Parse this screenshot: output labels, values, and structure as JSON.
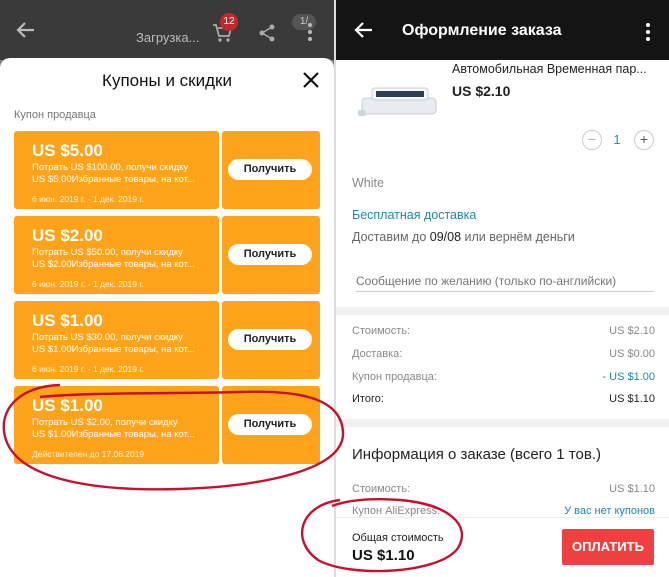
{
  "left": {
    "topbar": {
      "title": "Загрузка...",
      "cart_count": "12",
      "pager": "1/"
    },
    "sheet": {
      "title": "Купоны и скидки",
      "section_label": "Купон продавца",
      "coupons": [
        {
          "amount": "US $5.00",
          "line1": "Потрать US $100.00, получи скидку",
          "line2": "US $5.00Избранные товары, на кот...",
          "date": "6 июн. 2019 г. - 1 дек. 2019 г.",
          "button": "Получить"
        },
        {
          "amount": "US $2.00",
          "line1": "Потрать US $50.00, получи скидку",
          "line2": "US $2.00Избранные товары, на кот...",
          "date": "6 июн. 2019 г. - 1 дек. 2019 г.",
          "button": "Получить"
        },
        {
          "amount": "US $1.00",
          "line1": "Потрать US $30.00, получи скидку",
          "line2": "US $1.00Избранные товары, на кот...",
          "date": "6 июн. 2019 г. - 1 дек. 2019 г.",
          "button": "Получить"
        },
        {
          "amount": "US $1.00",
          "line1": "Потрать US $2.00, получи скидку",
          "line2": "US $1.00Избранные товары, на кот...",
          "date": "Действителен до 17.06.2019",
          "button": "Получить"
        }
      ]
    }
  },
  "right": {
    "title": "Оформление заказа",
    "product": {
      "name": "Автомобильная Временная пар...",
      "price": "US $2.10",
      "quantity": "1",
      "variant": "White"
    },
    "shipping": {
      "free": "Бесплатная доставка",
      "est_prefix": "Доставим до ",
      "est_date": "09/08",
      "est_suffix": " или вернём деньги"
    },
    "message_placeholder": "Сообщение по желанию (только по-английски)",
    "summary": {
      "cost_label": "Стоимость:",
      "cost_value": "US $2.10",
      "delivery_label": "Доставка:",
      "delivery_value": "US $0.00",
      "coupon_label": "Купон продавца:",
      "coupon_value": "- US $1.00",
      "total_label": "Итого:",
      "total_value": "US $1.10"
    },
    "order_info": {
      "title": "Информация о заказе (всего 1 тов.)",
      "cost_label": "Стоимость:",
      "cost_value": "US $1.10",
      "ali_coupon_label": "Купон AliExpress:",
      "ali_coupon_value": "У вас нет купонов"
    },
    "footer": {
      "total_label": "Общая стоимость",
      "total_value": "US $1.10",
      "pay_button": "ОПЛАТИТЬ"
    }
  },
  "colors": {
    "coupon": "#ffa31a",
    "link": "#1f86b4",
    "pay": "#ee4040",
    "annotation": "#c8102e"
  }
}
